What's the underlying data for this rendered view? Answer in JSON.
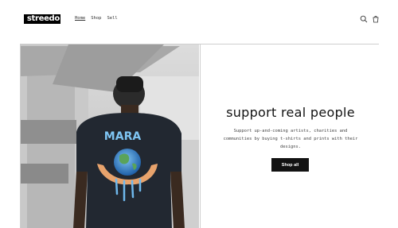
{
  "brand": {
    "logo_text": "streedo"
  },
  "nav": {
    "items": [
      {
        "label": "Home",
        "active": true
      },
      {
        "label": "Shop",
        "active": false
      },
      {
        "label": "Sell",
        "active": false
      }
    ]
  },
  "header_icons": [
    "search-icon",
    "cart-icon"
  ],
  "hero": {
    "shirt_print_text": "MARA",
    "heading": "support real people",
    "subtext": "Support up-and-coming artists, charities and communities by buying t-shirts and prints with their designs.",
    "cta_label": "Shop all"
  },
  "colors": {
    "text": "#121212",
    "button_bg": "#121212",
    "button_text": "#ffffff",
    "background": "#ffffff"
  }
}
